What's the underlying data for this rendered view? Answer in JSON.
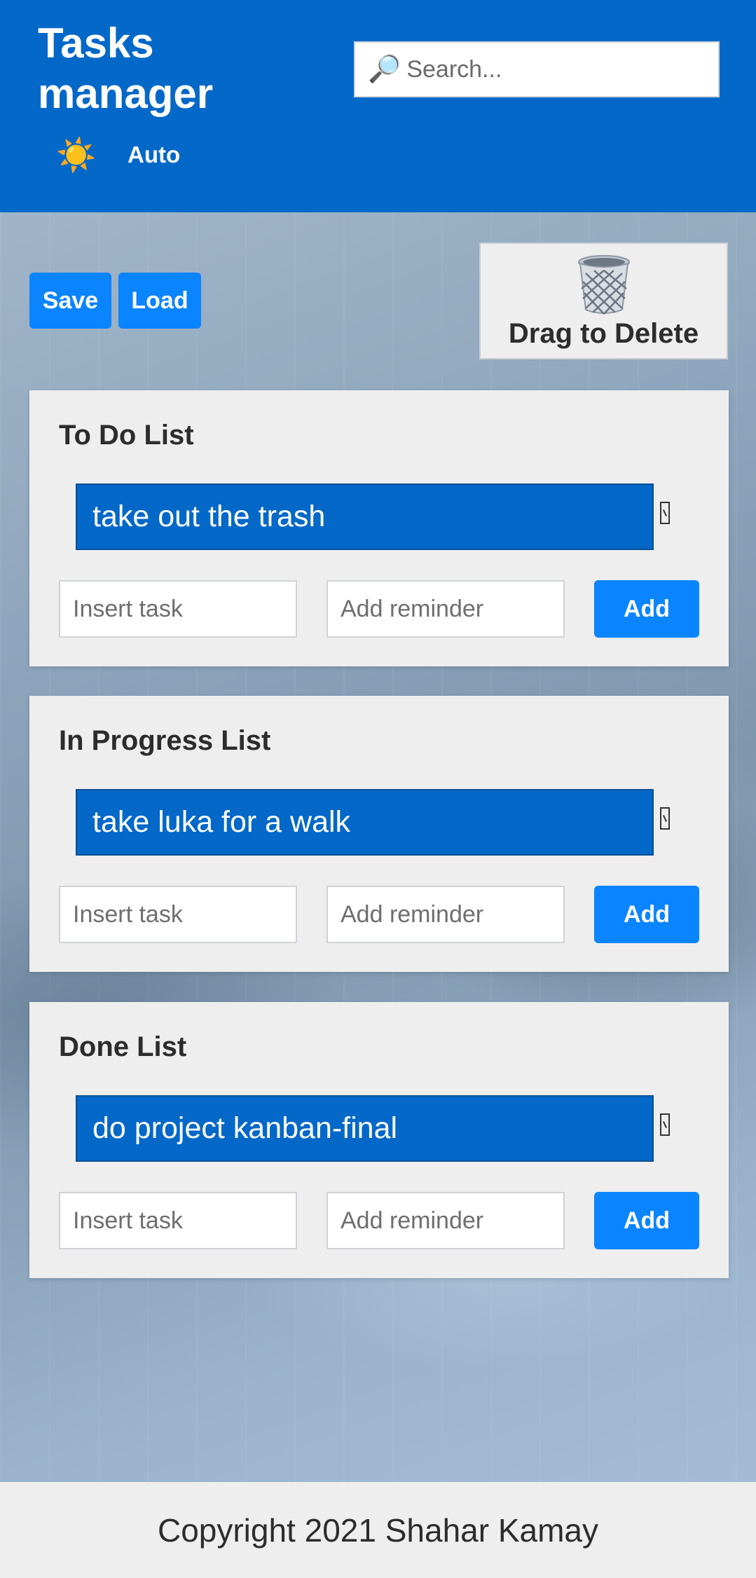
{
  "header": {
    "title": "Tasks manager",
    "theme_icon": "sun-icon",
    "theme_label": "Auto",
    "search": {
      "placeholder": "Search...",
      "icon": "magnifier-icon"
    }
  },
  "toolbar": {
    "save_label": "Save",
    "load_label": "Load",
    "trash_icon": "trash-can-icon",
    "trash_label": "Drag to Delete"
  },
  "lists": [
    {
      "title": "To Do List",
      "tasks": [
        "take out the trash"
      ],
      "task_placeholder": "Insert task",
      "reminder_placeholder": "Add reminder",
      "add_label": "Add"
    },
    {
      "title": "In Progress List",
      "tasks": [
        "take luka for a walk"
      ],
      "task_placeholder": "Insert task",
      "reminder_placeholder": "Add reminder",
      "add_label": "Add"
    },
    {
      "title": "Done List",
      "tasks": [
        "do project kanban-final"
      ],
      "task_placeholder": "Insert task",
      "reminder_placeholder": "Add reminder",
      "add_label": "Add"
    }
  ],
  "footer": {
    "copyright": "Copyright 2021 Shahar Kamay"
  },
  "colors": {
    "header_bg": "#0368c8",
    "button_bg": "#0a84ff",
    "task_bg": "#0368c8",
    "panel_bg": "#eeeeef"
  }
}
